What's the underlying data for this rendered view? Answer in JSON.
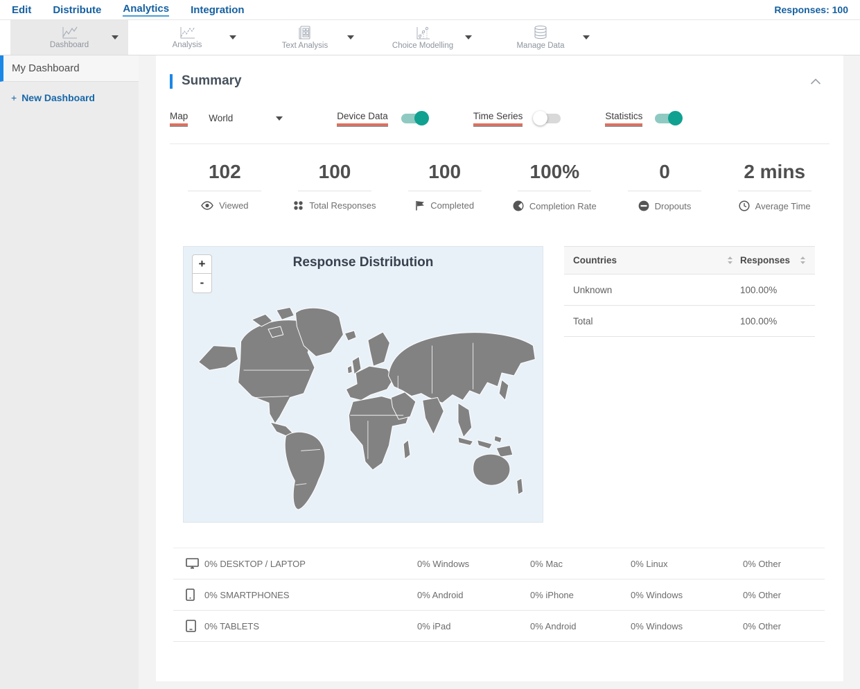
{
  "topnav": {
    "items": [
      {
        "label": "Edit",
        "active": false
      },
      {
        "label": "Distribute",
        "active": false
      },
      {
        "label": "Analytics",
        "active": true
      },
      {
        "label": "Integration",
        "active": false
      }
    ],
    "responses_label": "Responses: 100"
  },
  "toolbar": {
    "items": [
      {
        "label": "Dashboard",
        "icon": "line-chart-icon",
        "active": true
      },
      {
        "label": "Analysis",
        "icon": "line-chart-icon",
        "active": false
      },
      {
        "label": "Text Analysis",
        "icon": "document-grid-icon",
        "active": false
      },
      {
        "label": "Choice Modelling",
        "icon": "scatter-chart-icon",
        "active": false
      },
      {
        "label": "Manage Data",
        "icon": "database-icon",
        "active": false
      }
    ]
  },
  "sidebar": {
    "my_dashboard_label": "My Dashboard",
    "new_dashboard_plus": "+",
    "new_dashboard_label": "New Dashboard"
  },
  "summary": {
    "title": "Summary",
    "controls": {
      "map_label": "Map",
      "map_value": "World",
      "device_data_label": "Device Data",
      "device_data_on": true,
      "time_series_label": "Time Series",
      "time_series_on": false,
      "statistics_label": "Statistics",
      "statistics_on": true
    },
    "stats": [
      {
        "value": "102",
        "label": "Viewed",
        "icon": "eye-icon"
      },
      {
        "value": "100",
        "label": "Total Responses",
        "icon": "dots-grid-icon"
      },
      {
        "value": "100",
        "label": "Completed",
        "icon": "flag-icon"
      },
      {
        "value": "100%",
        "label": "Completion Rate",
        "icon": "half-circle-icon"
      },
      {
        "value": "0",
        "label": "Dropouts",
        "icon": "minus-circle-icon"
      },
      {
        "value": "2 mins",
        "label": "Average Time",
        "icon": "clock-icon"
      }
    ],
    "map": {
      "title": "Response Distribution",
      "zoom_in": "+",
      "zoom_out": "-"
    },
    "countries_table": {
      "col1_header": "Countries",
      "col2_header": "Responses",
      "rows": [
        {
          "country": "Unknown",
          "responses": "100.00%"
        },
        {
          "country": "Total",
          "responses": "100.00%"
        }
      ]
    },
    "device_table": {
      "rows": [
        {
          "icon": "desktop-icon",
          "cells": [
            "0% DESKTOP / LAPTOP",
            "0% Windows",
            "0% Mac",
            "0% Linux",
            "0% Other"
          ]
        },
        {
          "icon": "smartphone-icon",
          "cells": [
            "0% SMARTPHONES",
            "0% Android",
            "0% iPhone",
            "0% Windows",
            "0% Other"
          ]
        },
        {
          "icon": "tablet-icon",
          "cells": [
            "0% TABLETS",
            "0% iPad",
            "0% Android",
            "0% Windows",
            "0% Other"
          ]
        }
      ]
    }
  },
  "colors": {
    "nav_blue": "#1560a0",
    "accent_blue": "#1B87E6",
    "toggle_on_teal": "#10a191",
    "underline_red": "#ef6a56",
    "map_land_gray": "#828282",
    "map_bg_blue": "#e9f1f8"
  }
}
